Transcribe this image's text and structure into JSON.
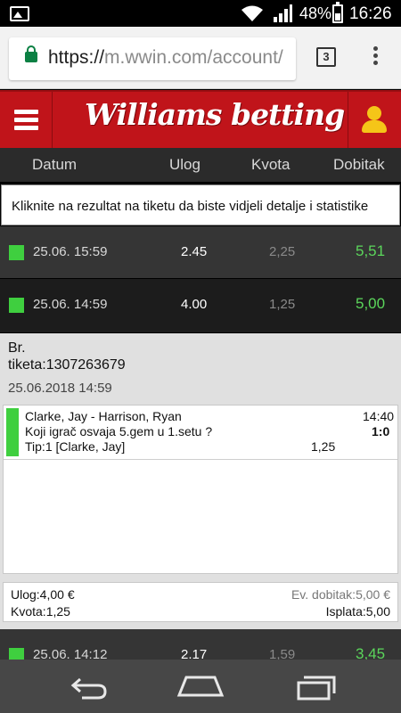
{
  "status_bar": {
    "battery_percent": "48%",
    "time": "16:26",
    "icons": [
      "gallery-icon",
      "wifi-icon",
      "signal-icon",
      "battery-charging-icon"
    ]
  },
  "browser": {
    "url_main": "https://",
    "url_host": "m.wwin.com",
    "url_path": "/account/",
    "tab_count": "3",
    "icons": [
      "lock-icon",
      "tabs-icon",
      "menu-dots-icon"
    ]
  },
  "site_header": {
    "logo_text": "Williams betting",
    "brand_color": "#c0141a",
    "icons": [
      "hamburger-menu-icon",
      "user-icon"
    ]
  },
  "columns": {
    "datum": "Datum",
    "ulog": "Ulog",
    "kvota": "Kvota",
    "dobitak": "Dobitak"
  },
  "info_banner": "Kliknite na rezultat na tiketu da biste vidjeli detalje i statistike",
  "tickets": [
    {
      "date": "25.06. 15:59",
      "stake": "2.45",
      "odds": "2,25",
      "win": "5,51",
      "status_color": "#3fcf3f"
    },
    {
      "date": "25.06. 14:59",
      "stake": "4.00",
      "odds": "1,25",
      "win": "5,00",
      "status_color": "#3fcf3f"
    },
    {
      "date": "25.06. 14:12",
      "stake": "2.17",
      "odds": "1,59",
      "win": "3,45",
      "status_color": "#3fcf3f"
    }
  ],
  "details": {
    "ticket_label": "Br.",
    "ticket_no": "tiketa:1307263679",
    "ticket_date": "25.06.2018 14:59",
    "bet": {
      "match": "Clarke, Jay - Harrison, Ryan",
      "time": "14:40",
      "question": "Koji igrač osvaja 5.gem u 1.setu ?",
      "score": "1:0",
      "tip": "Tip:1 [Clarke, Jay]",
      "odds": "1,25"
    },
    "summary": {
      "ulog": "Ulog:4,00 €",
      "ev_dobitak": "Ev. dobitak:5,00 €",
      "kvota": "Kvota:1,25",
      "isplata": "Isplata:5,00"
    }
  },
  "nav_bar": {
    "icons": [
      "back-icon",
      "home-icon",
      "recents-icon"
    ]
  }
}
